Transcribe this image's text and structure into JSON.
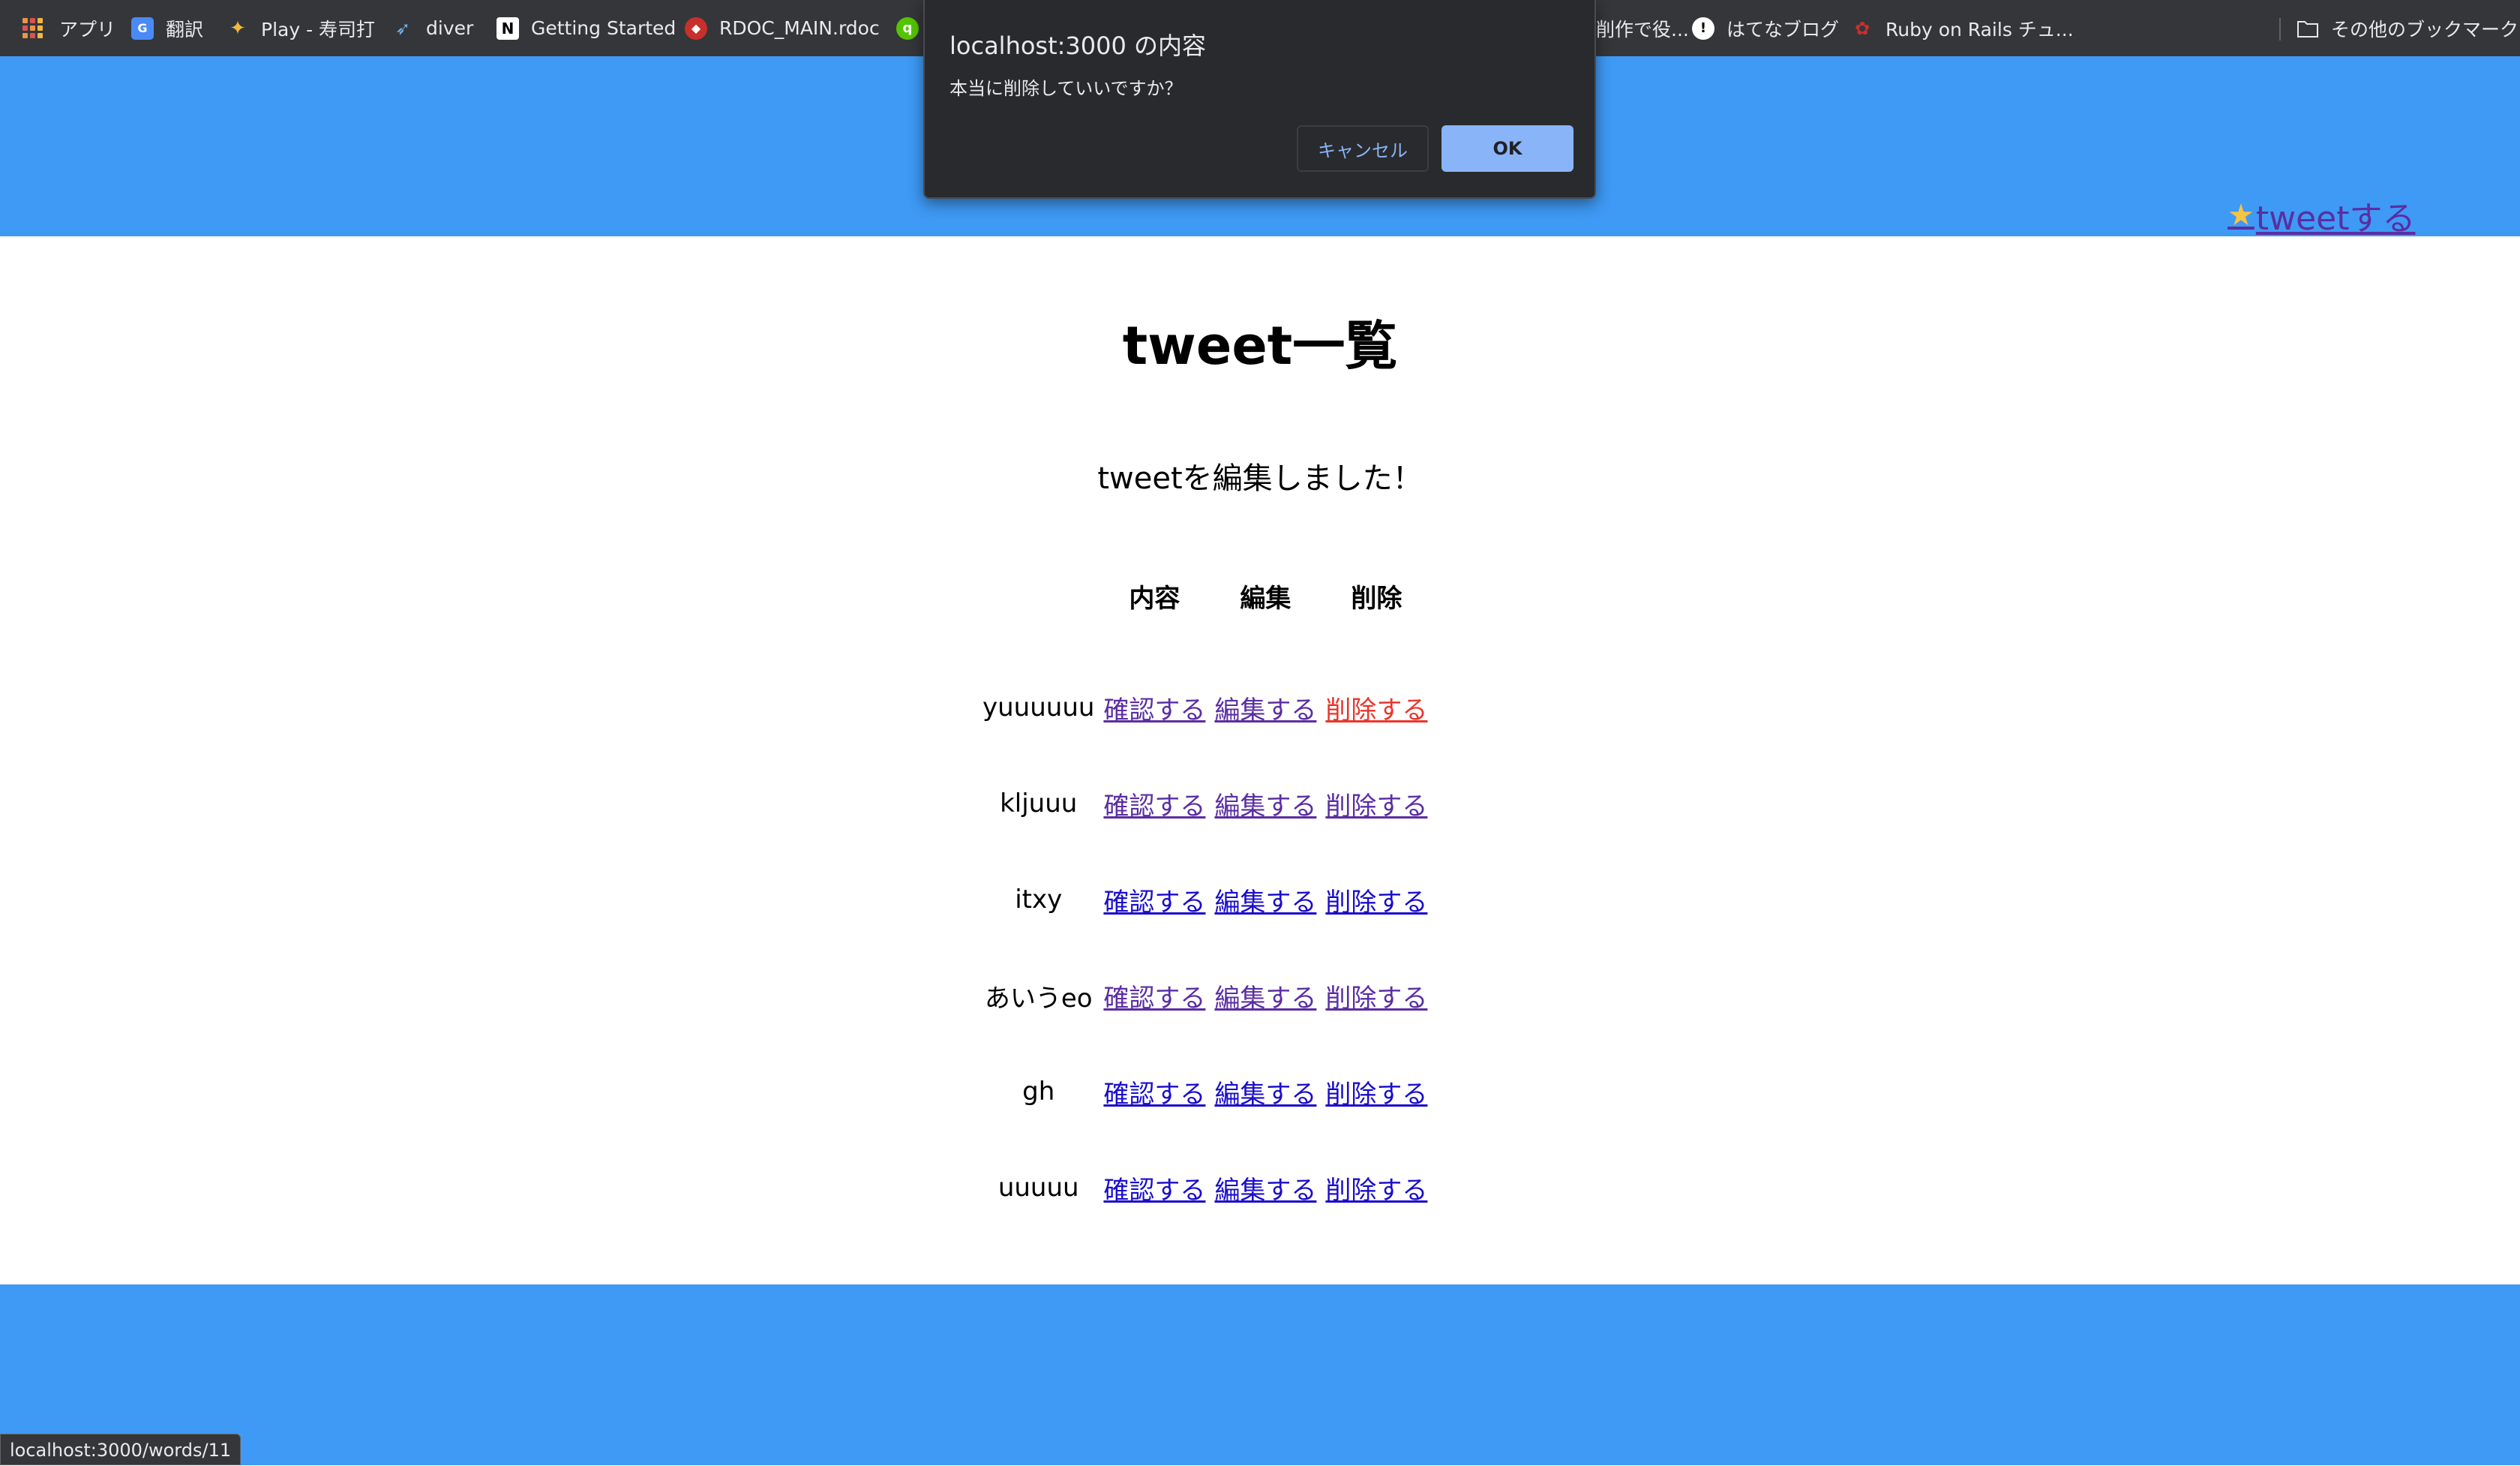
{
  "bookmarks": {
    "apps": "アプリ",
    "translate": "翻訳",
    "sushi": "Play - 寿司打",
    "diver": "diver",
    "getting_started": "Getting Started",
    "rdoc": "RDOC_MAIN.rdoc",
    "partial": "削作で役...",
    "hatena": "はてなブログ",
    "rails": "Ruby on Rails チュ...",
    "other": "その他のブックマーク"
  },
  "dialog": {
    "title": "localhost:3000 の内容",
    "message": "本当に削除していいですか？",
    "cancel_label": "キャンセル",
    "ok_label": "OK"
  },
  "header": {
    "tweet_link": "tweetする"
  },
  "main": {
    "title": "tweet一覧",
    "flash": "tweetを編集しました！",
    "columns": [
      "内容",
      "編集",
      "削除"
    ],
    "rows": [
      {
        "content": "yuuuuuu",
        "show": "確認する",
        "edit": "編集する",
        "delete": "削除する"
      },
      {
        "content": "kljuuu",
        "show": "確認する",
        "edit": "編集する",
        "delete": "削除する"
      },
      {
        "content": "itxy",
        "show": "確認する",
        "edit": "編集する",
        "delete": "削除する"
      },
      {
        "content": "あいうeo",
        "show": "確認する",
        "edit": "編集する",
        "delete": "削除する"
      },
      {
        "content": "gh",
        "show": "確認する",
        "edit": "編集する",
        "delete": "削除する"
      },
      {
        "content": "uuuuu",
        "show": "確認する",
        "edit": "編集する",
        "delete": "削除する"
      }
    ]
  },
  "status_bar": {
    "url": "localhost:3000/words/11"
  },
  "colors": {
    "header_bg": "#3e9af5",
    "link_visited": "#5a2ea3",
    "link_new": "#1a0dcc",
    "link_active": "#e8362b",
    "dialog_bg": "#292a2d",
    "dialog_ok": "#8ab4f8"
  }
}
